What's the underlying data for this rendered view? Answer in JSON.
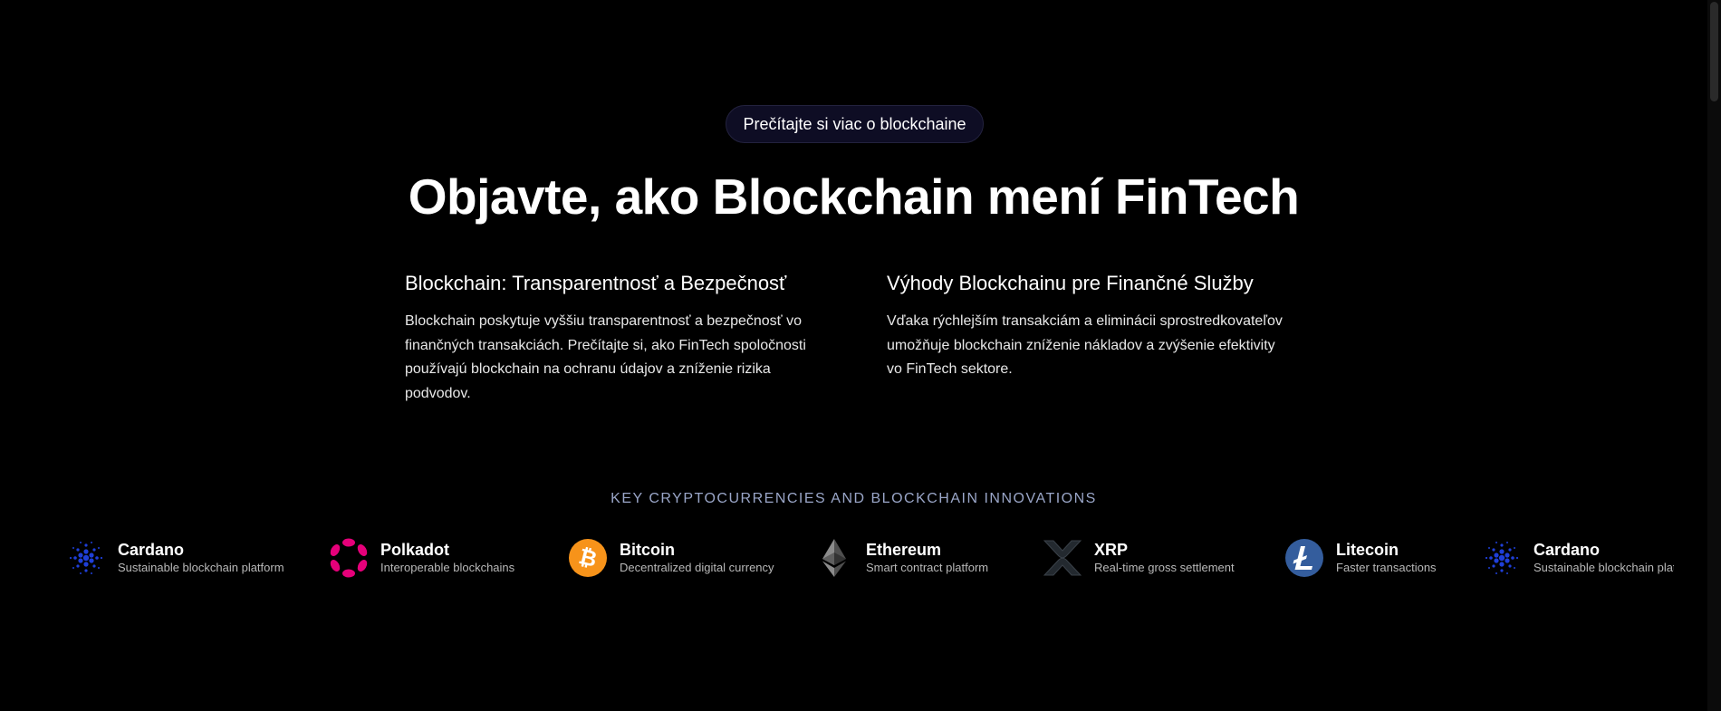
{
  "pill": {
    "label": "Prečítajte si viac o blockchaine"
  },
  "headline": "Objavte, ako Blockchain mení FinTech",
  "features": [
    {
      "title": "Blockchain: Transparentnosť a Bezpečnosť",
      "body": "Blockchain poskytuje vyššiu transparentnosť a bezpečnosť vo finančných transakciách. Prečítajte si, ako FinTech spoločnosti používajú blockchain na ochranu údajov a zníženie rizika podvodov."
    },
    {
      "title": "Výhody Blockchainu pre Finančné Služby",
      "body": "Vďaka rýchlejším transakciám a eliminácii sprostredkovateľov umožňuje blockchain zníženie nákladov a zvýšenie efektivity vo FinTech sektore."
    }
  ],
  "section_label": "KEY CRYPTOCURRENCIES AND BLOCKCHAIN INNOVATIONS",
  "ticker": [
    {
      "name": "Cardano",
      "desc": "Sustainable blockchain platform",
      "icon": "cardano-icon",
      "color": "#1f3fd8"
    },
    {
      "name": "Polkadot",
      "desc": "Interoperable blockchains",
      "icon": "polkadot-icon",
      "color": "#e6007a"
    },
    {
      "name": "Bitcoin",
      "desc": "Decentralized digital currency",
      "icon": "bitcoin-icon",
      "color": "#f7931a"
    },
    {
      "name": "Ethereum",
      "desc": "Smart contract platform",
      "icon": "ethereum-icon",
      "color": "#8c8c8c"
    },
    {
      "name": "XRP",
      "desc": "Real-time gross settlement",
      "icon": "xrp-icon",
      "color": "#23292f"
    },
    {
      "name": "Litecoin",
      "desc": "Faster transactions",
      "icon": "litecoin-icon",
      "color": "#345d9d"
    },
    {
      "name": "Cardano",
      "desc": "Sustainable blockchain platform",
      "icon": "cardano-icon",
      "color": "#1f3fd8"
    }
  ]
}
